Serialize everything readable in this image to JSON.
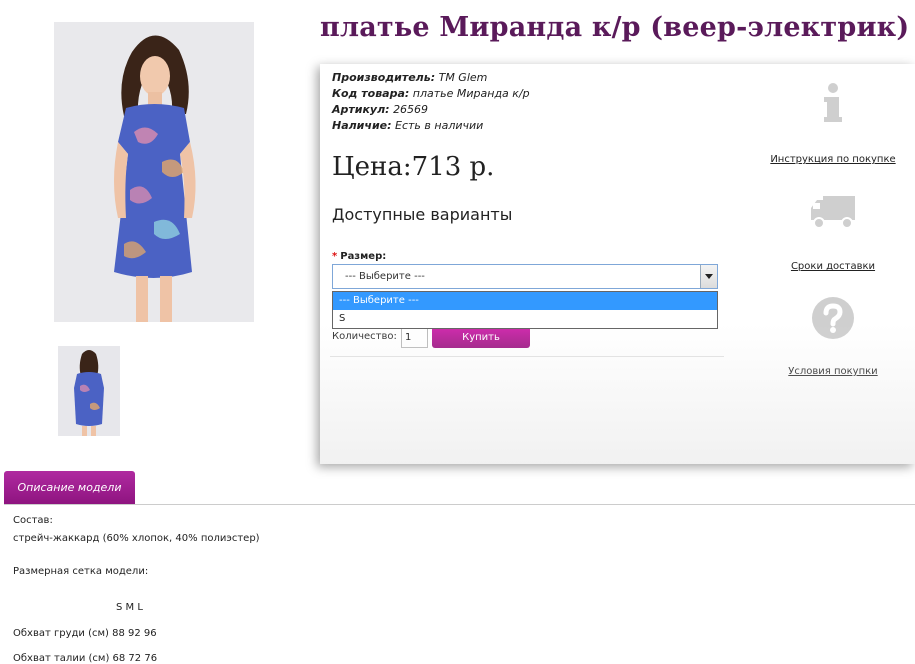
{
  "product": {
    "title": "платье Миранда к/р (веер-электрик)",
    "meta": [
      {
        "label": "Производитель:",
        "value": "TM Glem"
      },
      {
        "label": "Код товара:",
        "value": "платье Миранда к/р"
      },
      {
        "label": "Артикул:",
        "value": "26569"
      },
      {
        "label": "Наличие:",
        "value": "Есть в наличии"
      }
    ],
    "price": "Цена:713 р.",
    "variants_heading": "Доступные варианты"
  },
  "options": {
    "size_label": "Размер:",
    "required_mark": "*",
    "select_value": "--- Выберите ---",
    "dropdown_options": [
      "--- Выберите ---",
      "S"
    ]
  },
  "purchase": {
    "quantity_label": "Количество:",
    "quantity_value": "1",
    "buy_label": "Купить"
  },
  "side_links": [
    {
      "label": "Инструкция по покупке",
      "icon": "info-icon"
    },
    {
      "label": "Сроки доставки",
      "icon": "delivery-truck-icon"
    },
    {
      "label": "Условия покупки",
      "icon": "question-icon"
    }
  ],
  "tabs": {
    "description_label": "Описание модели"
  },
  "description": {
    "composition_label": "Состав:",
    "composition_value": "стрейч-жаккард (60% хлопок, 40% полиэстер)",
    "size_grid_label": "Размерная сетка модели:",
    "size_header": "S  M  L",
    "rows": [
      "Обхват груди (см) 88 92 96",
      "Обхват талии (см) 68 72 76"
    ]
  },
  "colors": {
    "title": "#5a1a5a",
    "accent": "#a01d8f",
    "dropdown_highlight": "#3399ff"
  }
}
